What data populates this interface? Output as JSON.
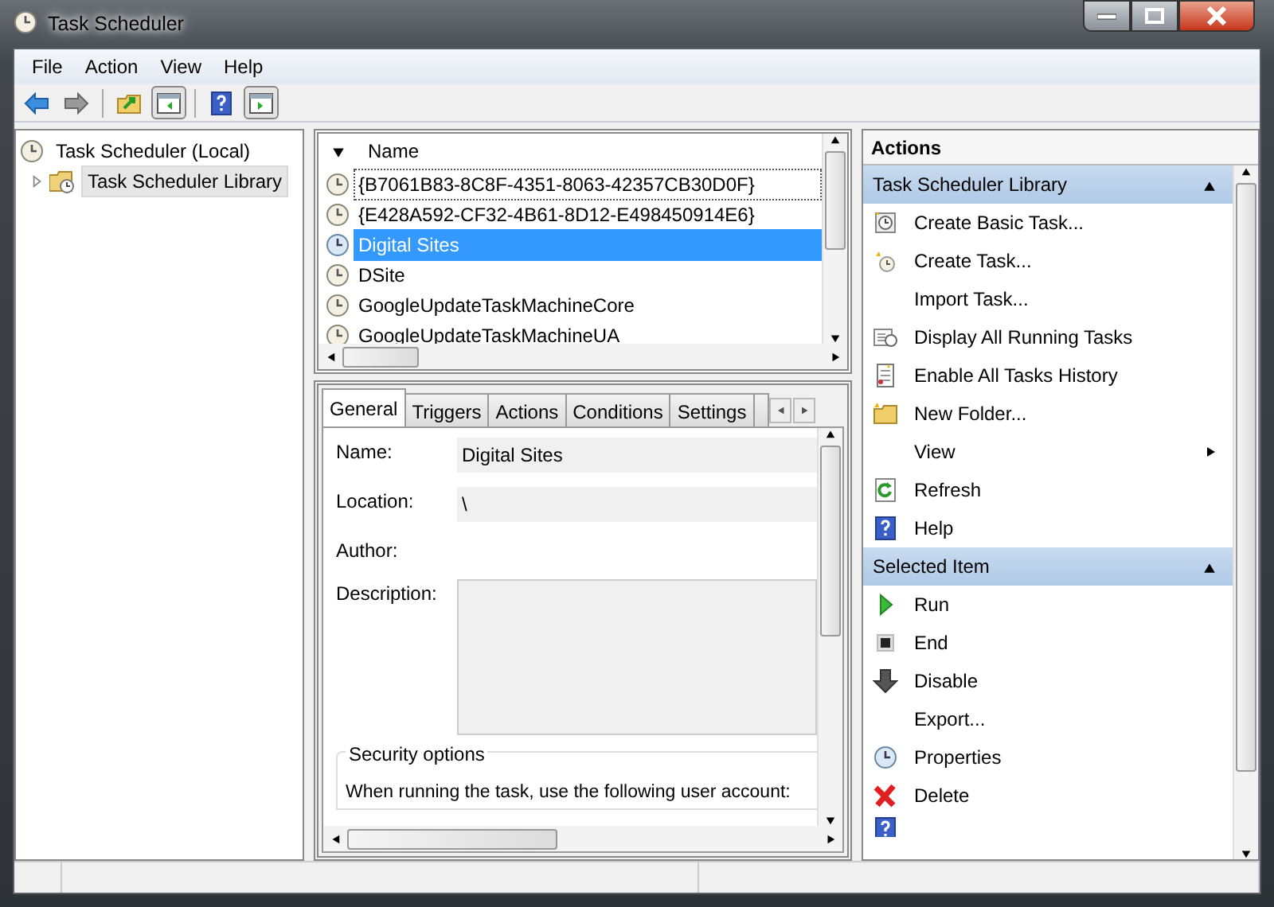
{
  "window": {
    "title": "Task Scheduler"
  },
  "menu": [
    "File",
    "Action",
    "View",
    "Help"
  ],
  "tree": [
    {
      "label": "Task Scheduler (Local)",
      "selected": false,
      "expanded": true,
      "children": [
        {
          "label": "Task Scheduler Library",
          "selected": true,
          "expanded": false
        }
      ]
    }
  ],
  "task_list": {
    "columns": [
      "Name"
    ],
    "rows": [
      {
        "name": "{B7061B83-8C8F-4351-8063-42357CB30D0F}",
        "selected": false,
        "focused": true
      },
      {
        "name": "{E428A592-CF32-4B61-8D12-E498450914E6}",
        "selected": false,
        "focused": false
      },
      {
        "name": "Digital Sites",
        "selected": true,
        "focused": false
      },
      {
        "name": "DSite",
        "selected": false,
        "focused": false
      },
      {
        "name": "GoogleUpdateTaskMachineCore",
        "selected": false,
        "focused": false
      },
      {
        "name": "GoogleUpdateTaskMachineUA",
        "selected": false,
        "focused": false
      }
    ]
  },
  "detail_tabs": [
    {
      "label": "General",
      "selected": true
    },
    {
      "label": "Triggers",
      "selected": false
    },
    {
      "label": "Actions",
      "selected": false
    },
    {
      "label": "Conditions",
      "selected": false
    },
    {
      "label": "Settings",
      "selected": false
    }
  ],
  "general": {
    "fields": [
      {
        "label": "Name:",
        "value": "Digital Sites",
        "kind": "box"
      },
      {
        "label": "Location:",
        "value": "\\",
        "kind": "box"
      },
      {
        "label": "Author:",
        "kind": "plain"
      },
      {
        "label": "Description:",
        "kind": "area"
      }
    ],
    "security_title": "Security options",
    "security_text": "When running the task, use the following user account:"
  },
  "actions": {
    "title": "Actions",
    "sections": [
      {
        "title": "Task Scheduler Library",
        "items": [
          {
            "label": "Create Basic Task..."
          },
          {
            "label": "Create Task..."
          },
          {
            "label": "Import Task..."
          },
          {
            "label": "Display All Running Tasks"
          },
          {
            "label": "Enable All Tasks History"
          },
          {
            "label": "New Folder..."
          },
          {
            "label": "View",
            "submenu": true
          },
          {
            "label": "Refresh"
          },
          {
            "label": "Help"
          }
        ]
      },
      {
        "title": "Selected Item",
        "items": [
          {
            "label": "Run"
          },
          {
            "label": "End"
          },
          {
            "label": "Disable"
          },
          {
            "label": "Export..."
          },
          {
            "label": "Properties"
          },
          {
            "label": "Delete"
          }
        ]
      }
    ]
  }
}
